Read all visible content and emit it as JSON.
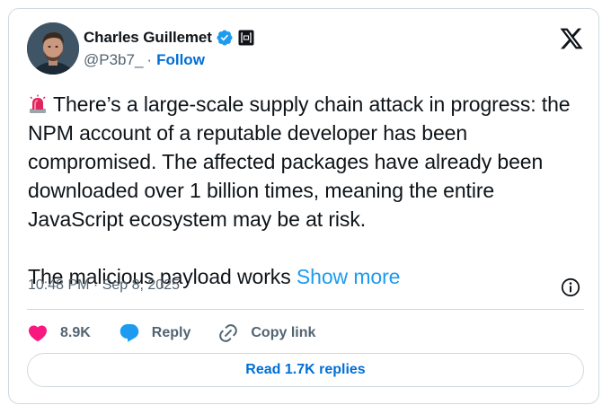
{
  "author": {
    "name": "Charles Guillemet",
    "handle": "@P3b7_",
    "separator": "·",
    "follow_label": "Follow",
    "verified_color": "#1d9bf0"
  },
  "tweet": {
    "emoji_icon": "rotating-light-icon",
    "paragraph1": "There’s a large-scale supply chain attack in progress: the NPM account of a reputable developer has been compromised. The affected packages have already been downloaded over 1 billion times, meaning the entire JavaScript ecosystem may be at risk.",
    "paragraph2": "The malicious payload works ",
    "show_more_label": "Show more",
    "timestamp": "10:48 PM · Sep 8, 2025"
  },
  "actions": {
    "likes_count": "8.9K",
    "like_color": "#f91880",
    "reply_label": "Reply",
    "reply_color": "#1d9bf0",
    "copy_link_label": "Copy link"
  },
  "read_replies_label": "Read 1.7K replies"
}
